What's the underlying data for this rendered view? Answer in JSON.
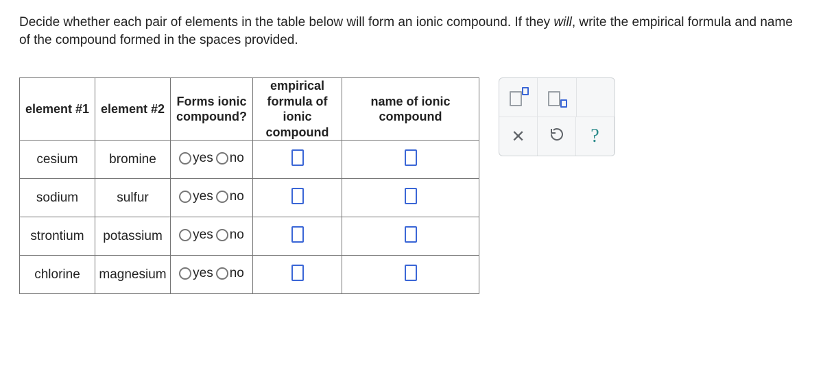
{
  "instructions": {
    "pre": "Decide whether each pair of elements in the table below will form an ionic compound. If they ",
    "will": "will",
    "post": ", write the empirical formula and name of the compound formed in the spaces provided."
  },
  "headers": {
    "e1": "element #1",
    "e2": "element #2",
    "forms_line1": "Forms ionic",
    "forms_line2": "compound?",
    "formula_line1": "empirical",
    "formula_line2": "formula of ionic",
    "formula_line3": "compound",
    "name": "name of ionic compound"
  },
  "radio": {
    "yes": "yes",
    "no": "no"
  },
  "rows": [
    {
      "e1": "cesium",
      "e2": "bromine"
    },
    {
      "e1": "sodium",
      "e2": "sulfur"
    },
    {
      "e1": "strontium",
      "e2": "potassium"
    },
    {
      "e1": "chlorine",
      "e2": "magnesium"
    }
  ],
  "palette": {
    "sup_label": "superscript-tool",
    "sub_label": "subscript-tool",
    "x_label": "clear-tool",
    "reset_label": "reset-tool",
    "help": "?"
  }
}
